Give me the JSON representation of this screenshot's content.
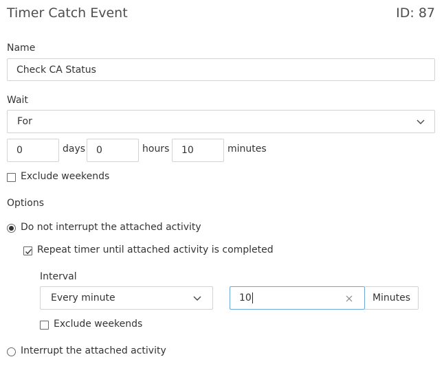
{
  "header": {
    "title": "Timer Catch Event",
    "id_text": "ID: 87"
  },
  "name_section": {
    "label": "Name",
    "value": "Check CA Status"
  },
  "wait_section": {
    "label": "Wait",
    "mode": "For",
    "days_value": "0",
    "days_label": "days",
    "hours_value": "0",
    "hours_label": "hours",
    "minutes_value": "10",
    "minutes_label": "minutes",
    "exclude_weekends_label": "Exclude weekends",
    "exclude_weekends_checked": false
  },
  "options": {
    "label": "Options",
    "no_interrupt_label": "Do not interrupt the attached activity",
    "no_interrupt_selected": true,
    "repeat_label": "Repeat timer until attached activity is completed",
    "repeat_checked": true,
    "interval": {
      "label": "Interval",
      "mode": "Every minute",
      "value": "10",
      "unit": "Minutes",
      "exclude_weekends_label": "Exclude weekends",
      "exclude_weekends_checked": false
    },
    "interrupt_label": "Interrupt the attached activity",
    "interrupt_selected": false
  },
  "icons": {
    "dropdown": "chevron-down-icon",
    "clear": "clear-icon",
    "check": "check-icon"
  },
  "colors": {
    "focus_border": "#6aa7d8",
    "border": "#cfd3d6",
    "text": "#333333"
  }
}
